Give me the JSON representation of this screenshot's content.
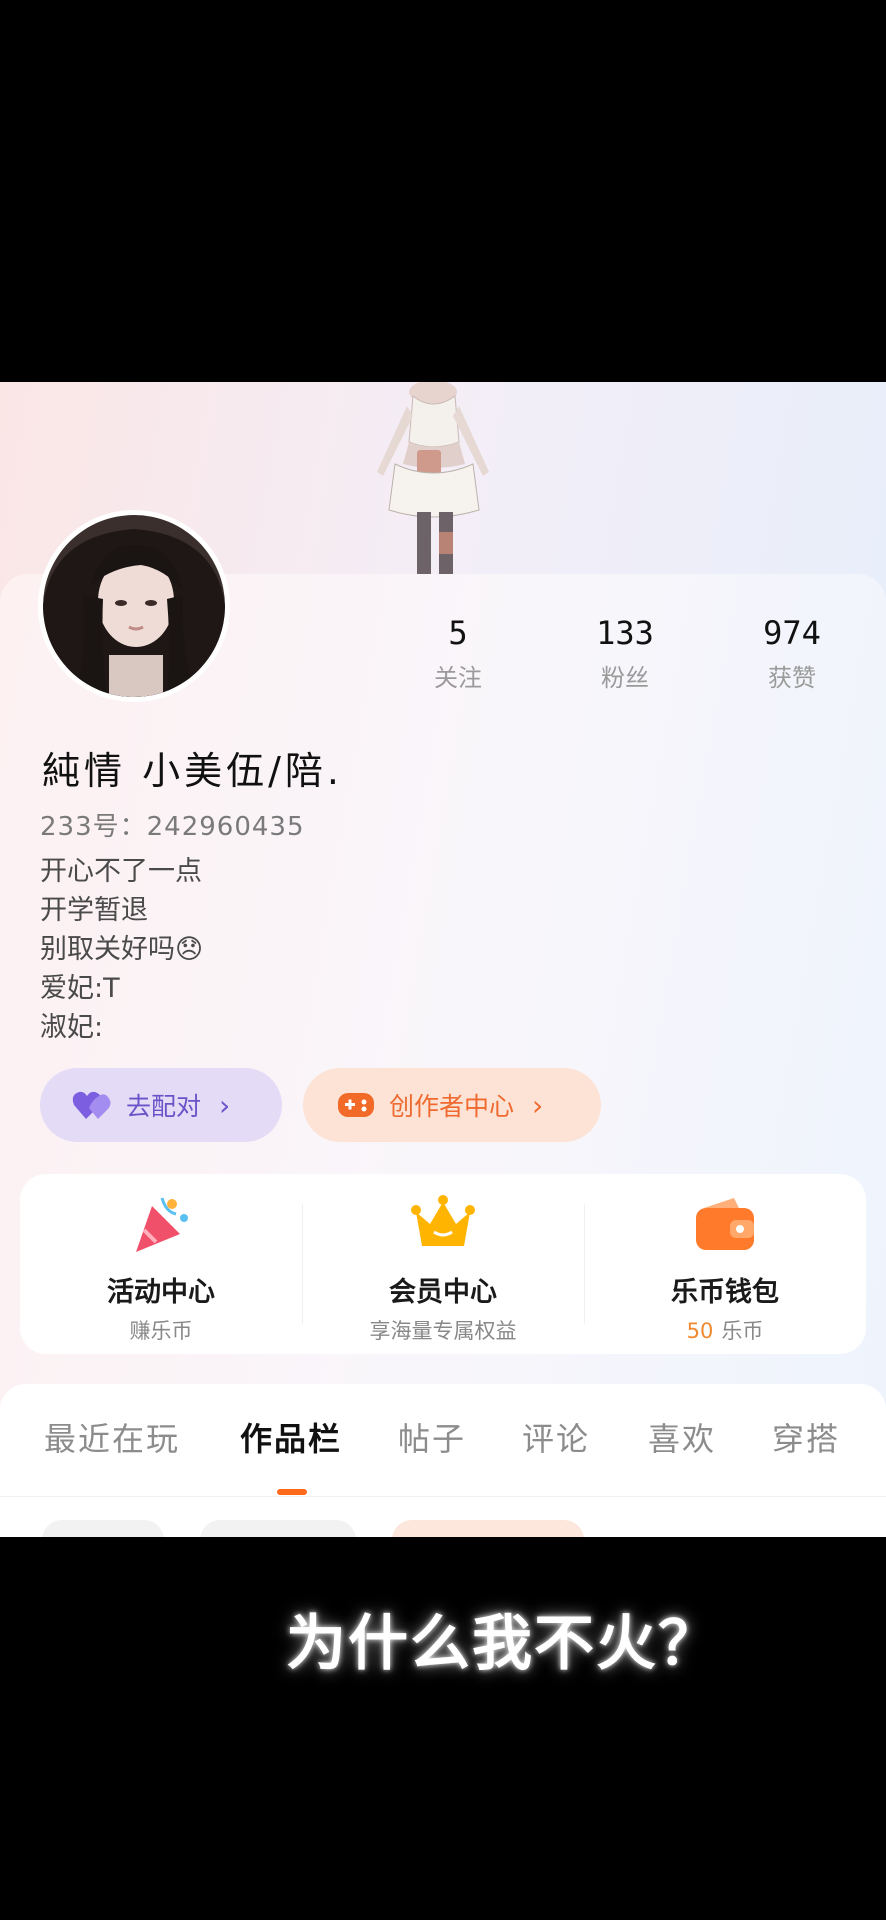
{
  "profile": {
    "name": "純情 小美伍/陪.",
    "uid": "233号：242960435",
    "bio": [
      "开心不了一点",
      "开学暂退",
      "别取关好吗😞",
      "爱妃:T",
      "淑妃:"
    ]
  },
  "stats": [
    {
      "value": "5",
      "label": "关注"
    },
    {
      "value": "133",
      "label": "粉丝"
    },
    {
      "value": "974",
      "label": "获赞"
    }
  ],
  "actions": {
    "match_label": "去配对",
    "creator_label": "创作者中心"
  },
  "services": [
    {
      "title": "活动中心",
      "subtitle": "赚乐币",
      "icon": "party-popper-icon"
    },
    {
      "title": "会员中心",
      "subtitle": "享海量专属权益",
      "icon": "crown-icon"
    },
    {
      "title": "乐币钱包",
      "coin_value": "50",
      "subtitle": "乐币",
      "icon": "wallet-icon"
    }
  ],
  "tabs": [
    "最近在玩",
    "作品栏",
    "帖子",
    "评论",
    "喜欢",
    "穿搭"
  ],
  "active_tab": "作品栏",
  "caption": "为什么我不火？",
  "colors": {
    "accent_orange": "#ff6a1a",
    "match_purple": "#6a52c9",
    "creator_orange": "#ee6a2f"
  }
}
